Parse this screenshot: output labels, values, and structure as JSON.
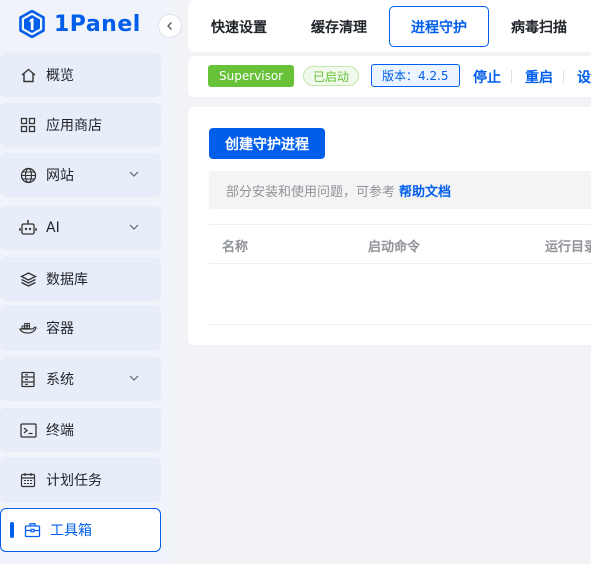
{
  "app": {
    "logo_text": "1Panel"
  },
  "sidebar": {
    "items": [
      {
        "label": "概览",
        "icon": "home-icon",
        "has_chevron": false
      },
      {
        "label": "应用商店",
        "icon": "apps-icon",
        "has_chevron": false
      },
      {
        "label": "网站",
        "icon": "globe-icon",
        "has_chevron": true
      },
      {
        "label": "AI",
        "icon": "robot-icon",
        "has_chevron": true
      },
      {
        "label": "数据库",
        "icon": "layers-icon",
        "has_chevron": false
      },
      {
        "label": "容器",
        "icon": "docker-icon",
        "has_chevron": false
      },
      {
        "label": "系统",
        "icon": "server-icon",
        "has_chevron": true
      },
      {
        "label": "终端",
        "icon": "terminal-icon",
        "has_chevron": false
      },
      {
        "label": "计划任务",
        "icon": "calendar-icon",
        "has_chevron": false
      },
      {
        "label": "工具箱",
        "icon": "toolbox-icon",
        "has_chevron": false,
        "active": true
      }
    ]
  },
  "tabs": [
    {
      "label": "快速设置"
    },
    {
      "label": "缓存清理"
    },
    {
      "label": "进程守护",
      "active": true
    },
    {
      "label": "病毒扫描"
    }
  ],
  "status": {
    "service_name": "Supervisor",
    "state": "已启动",
    "version": "版本：4.2.5",
    "actions": [
      "停止",
      "重启",
      "设"
    ]
  },
  "main": {
    "create_button": "创建守护进程",
    "notice_text": "部分安装和使用问题，可参考",
    "notice_link": "帮助文档",
    "table": {
      "columns": [
        "名称",
        "启动命令",
        "运行目录"
      ]
    }
  },
  "colors": {
    "accent": "#005eeb",
    "success": "#67c23a",
    "sidebar_bg": "#f0f3f9",
    "page_bg": "#f1f3f7"
  }
}
